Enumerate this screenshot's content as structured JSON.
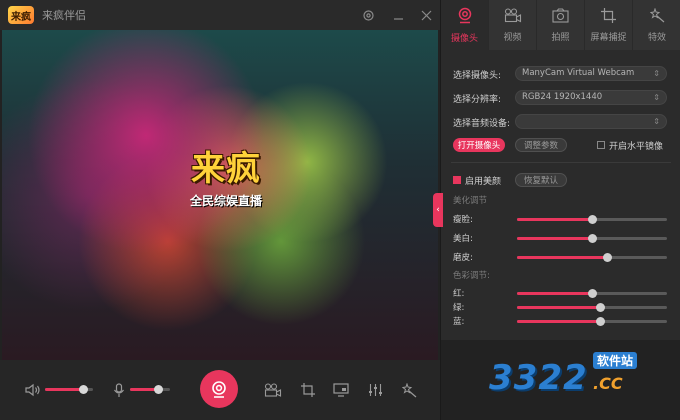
{
  "app": {
    "title": "来疯伴侣",
    "logo_text": "来疯"
  },
  "titlebar": {
    "settings_icon": "gear-icon",
    "minimize_icon": "minimize-icon",
    "close_icon": "close-icon"
  },
  "preview": {
    "brand_logo": "来疯",
    "brand_slogan": "全民综娱直播"
  },
  "bottombar": {
    "volume_level": 0.8,
    "mic_level": 0.7,
    "icons": [
      "speaker-icon",
      "microphone-icon",
      "live-camera-icon",
      "video-icon",
      "crop-icon",
      "screen-share-icon",
      "equalizer-icon",
      "effects-icon"
    ]
  },
  "tabs": [
    {
      "label": "摄像头",
      "icon": "webcam-icon",
      "active": true
    },
    {
      "label": "视频",
      "icon": "video-camera-icon",
      "active": false
    },
    {
      "label": "拍照",
      "icon": "camera-icon",
      "active": false
    },
    {
      "label": "屏幕捕捉",
      "icon": "crop-icon",
      "active": false
    },
    {
      "label": "特效",
      "icon": "magic-wand-icon",
      "active": false
    }
  ],
  "camera": {
    "select_camera_label": "选择摄像头:",
    "select_camera_value": "ManyCam Virtual Webcam",
    "resolution_label": "选择分辨率:",
    "resolution_value": "RGB24 1920x1440",
    "audio_label": "选择音频设备:",
    "audio_value": "",
    "open_camera_button": "打开摄像头",
    "adjust_params_button": "调整参数",
    "mirror_label": "开启水平镜像",
    "mirror_checked": false
  },
  "beauty": {
    "enable_label": "启用美颜",
    "enable_checked": true,
    "reset_button": "恢复默认",
    "section_title": "美化调节",
    "sliders": [
      {
        "label": "瘦脸:",
        "value": 0.5
      },
      {
        "label": "美白:",
        "value": 0.5
      },
      {
        "label": "磨皮:",
        "value": 0.6
      }
    ]
  },
  "color": {
    "section_title": "色彩调节:",
    "sliders": [
      {
        "label": "红:",
        "value": 0.5
      },
      {
        "label": "绿:",
        "value": 0.55
      },
      {
        "label": "蓝:",
        "value": 0.55
      }
    ]
  },
  "watermark": {
    "number": "3322",
    "sub": "软件站",
    "cc": ".CC"
  },
  "colors": {
    "accent": "#e8365d",
    "panel": "#2b2b2b",
    "dark": "#222222"
  }
}
